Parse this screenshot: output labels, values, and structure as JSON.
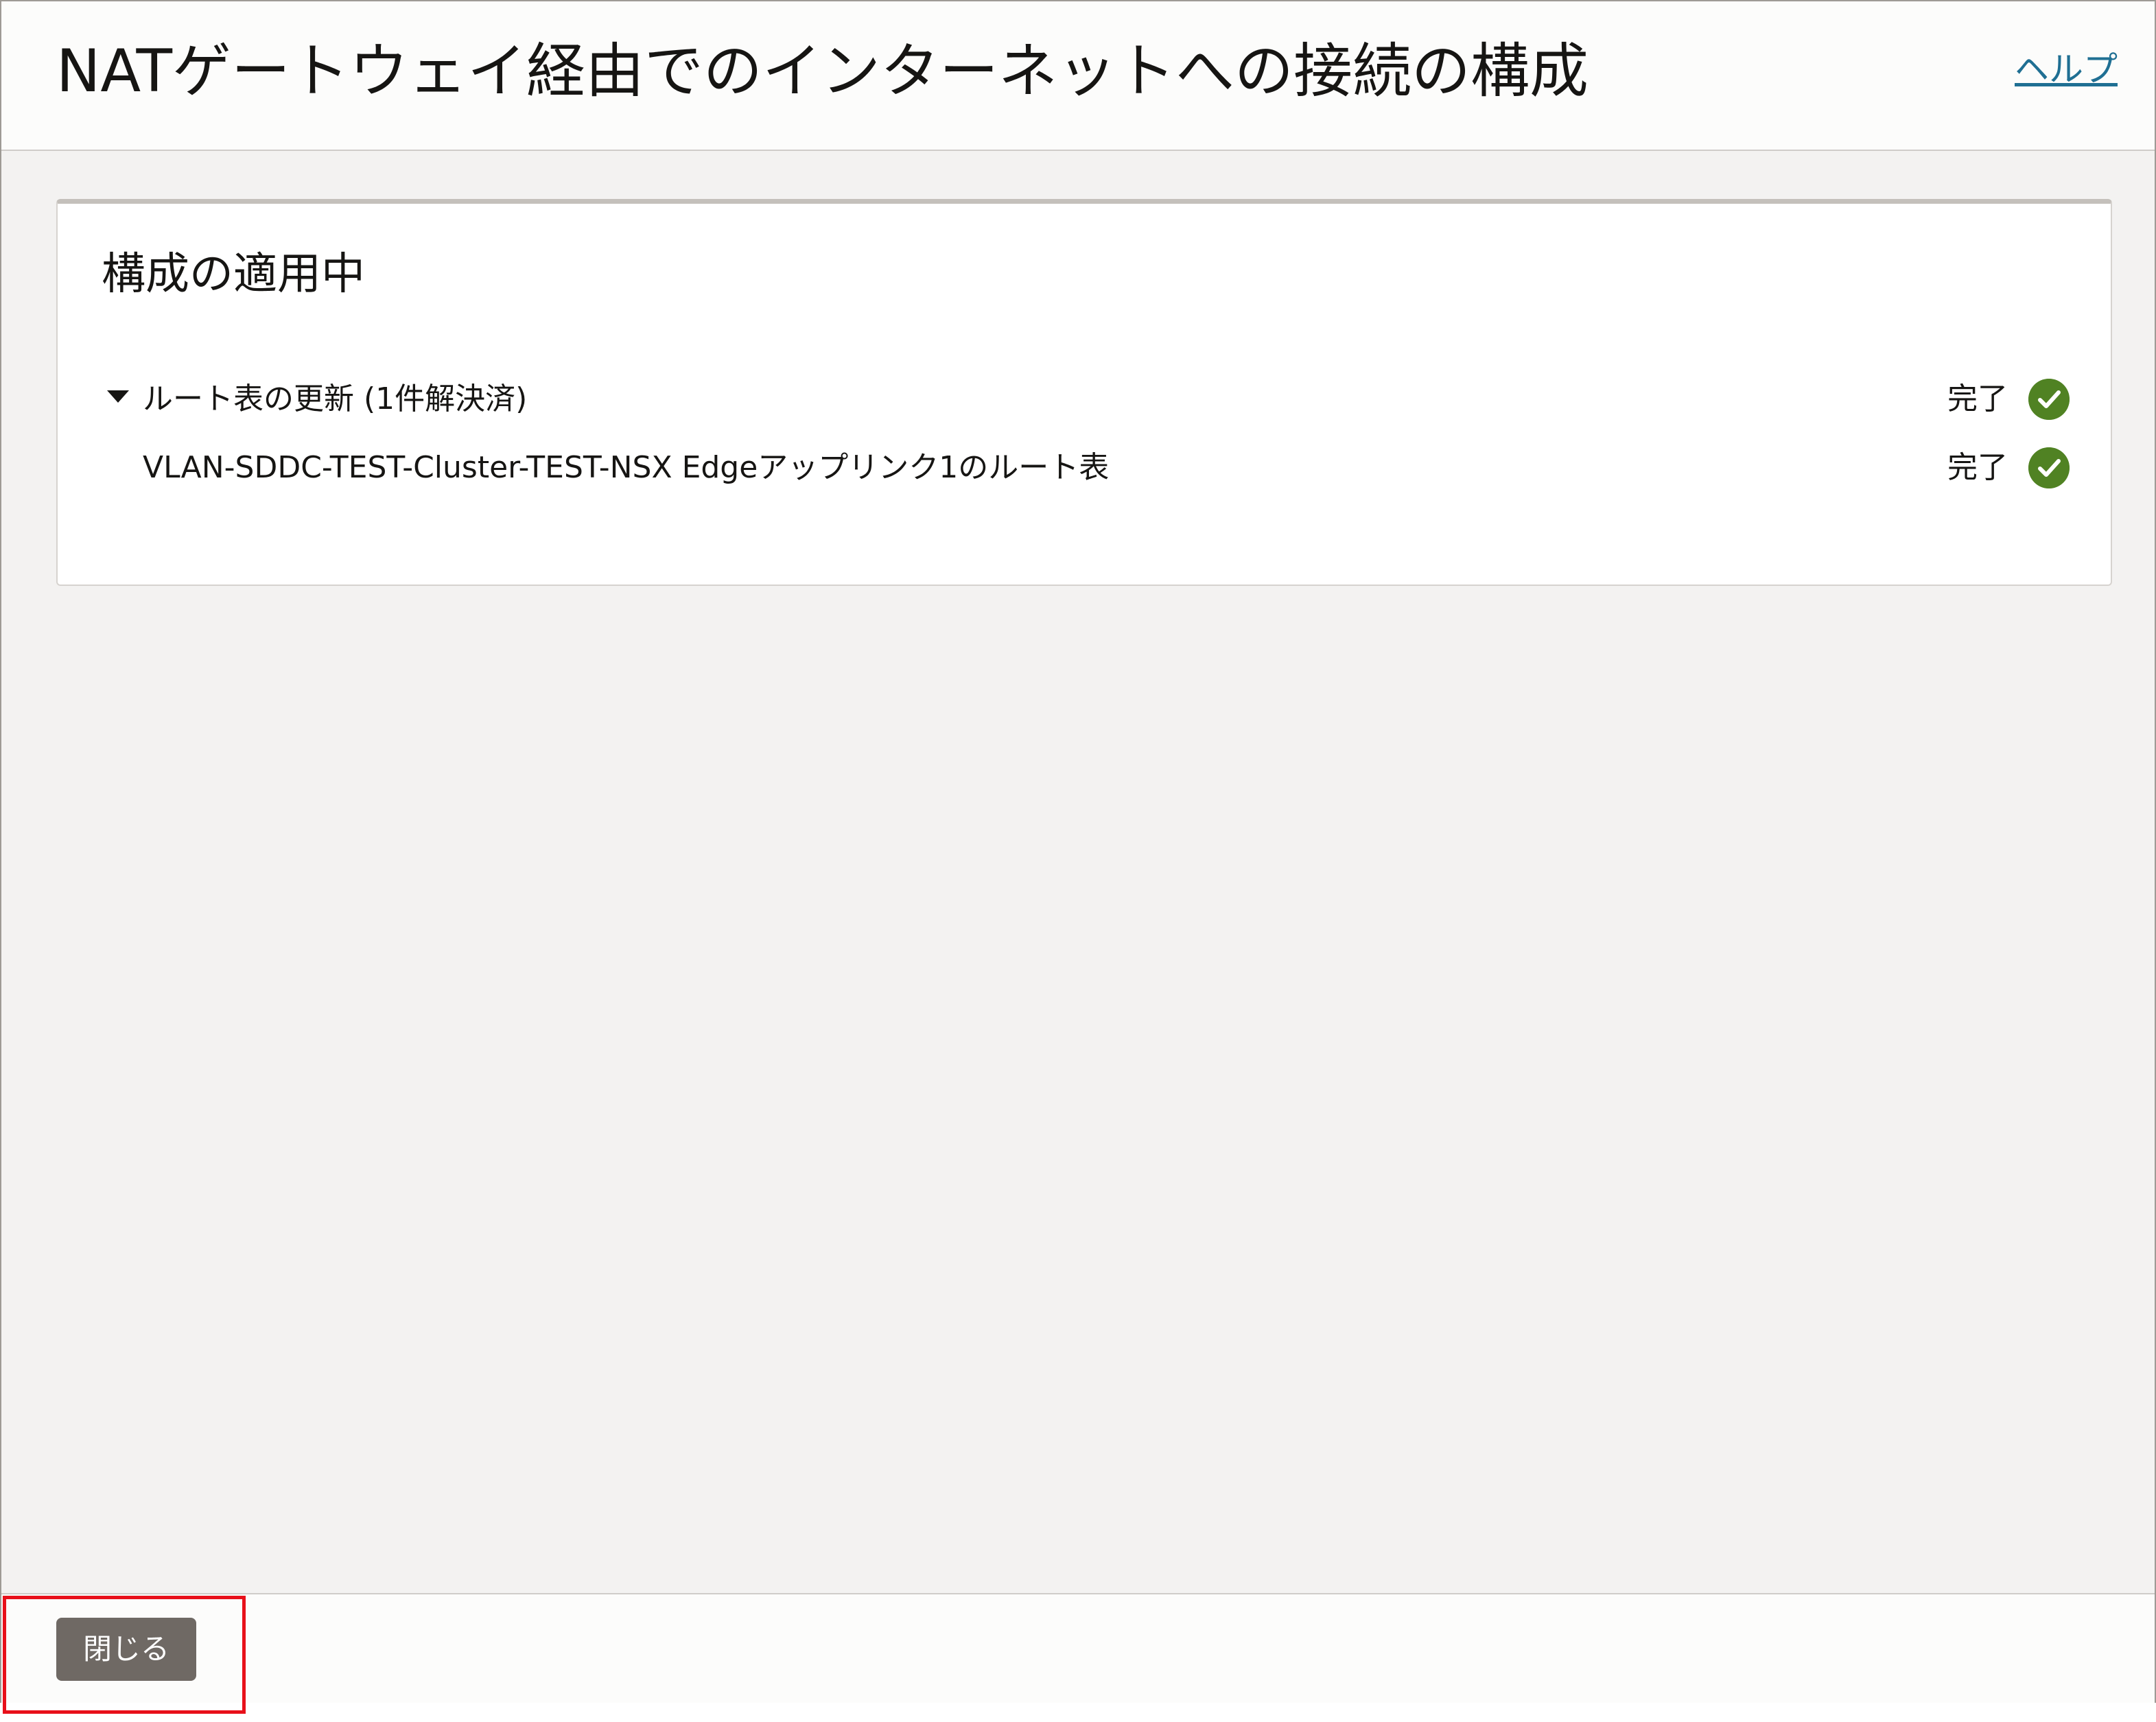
{
  "header": {
    "title": "NATゲートウェイ経由でのインターネットへの接続の構成",
    "help_link": "ヘルプ"
  },
  "card": {
    "title": "構成の適用中",
    "group": {
      "label": "ルート表の更新 (1件解決済)",
      "status": "完了",
      "items": [
        {
          "label": "VLAN-SDDC-TEST-Cluster-TEST-NSX Edgeアップリンク1のルート表",
          "status": "完了"
        }
      ]
    }
  },
  "footer": {
    "close_label": "閉じる"
  },
  "icons": {
    "disclosure": "triangle-down-icon",
    "status": "check-circle-icon"
  },
  "colors": {
    "success": "#508223",
    "link": "#1f6f93",
    "button": "#6f6964",
    "highlight": "#e8101a"
  }
}
